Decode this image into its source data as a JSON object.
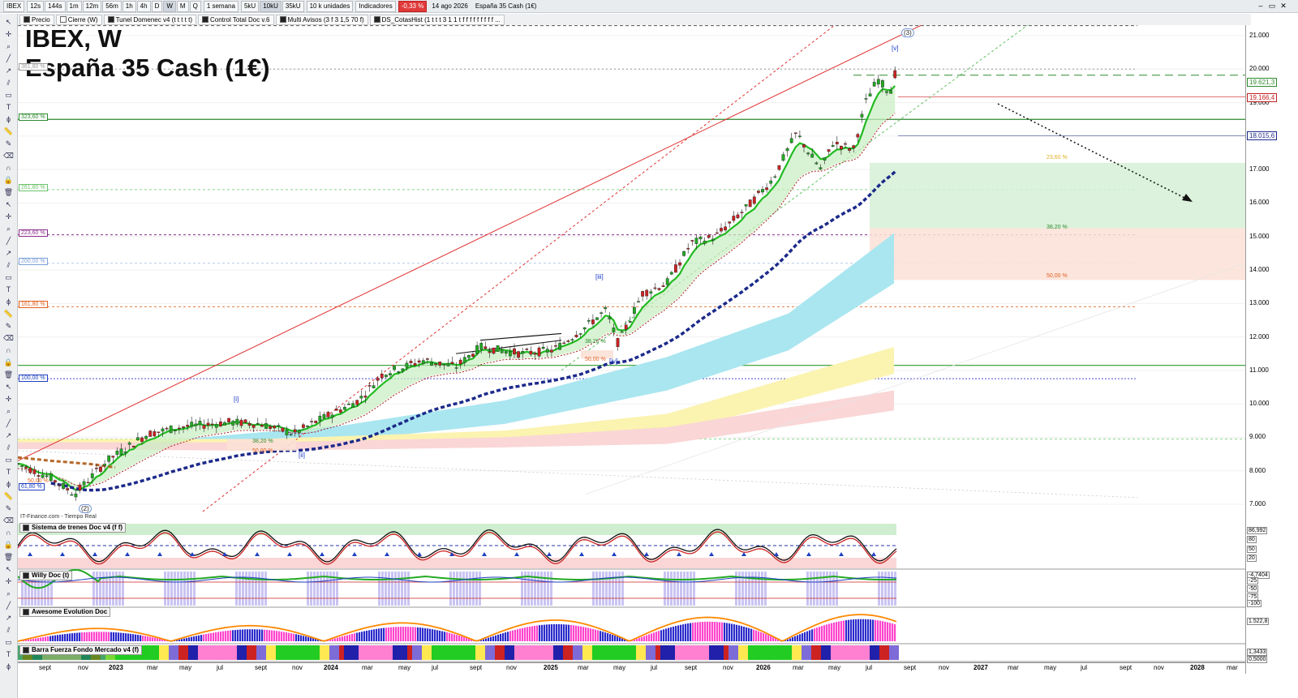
{
  "toolbar": {
    "symbol": "IBEX",
    "periods": [
      "12s",
      "144s",
      "1m",
      "12m",
      "56m",
      "1h",
      "4h",
      "D",
      "W",
      "M",
      "Q"
    ],
    "period_selected": "W",
    "timeframe": "1 semana",
    "units": [
      "5kU",
      "10kU",
      "35kU"
    ],
    "units_selected": "10kU",
    "units_count": "10 k unidades",
    "indicators_label": "Indicadores",
    "change": "-0,33 %",
    "date": "14 ago 2026",
    "instrument": "España 35 Cash (1€)"
  },
  "indicators_bar": [
    "Precio",
    "Cierre (W)",
    "Tunel Domenec v4 (t t t t t)",
    "Control Total Doc v.6",
    "Multi Avisos (3 f 3 1,5 70 f)",
    "DS_CotasHist (1 t t t 3 1 1 t f f f f f f f f f ..."
  ],
  "chart": {
    "title_line1": "IBEX, W",
    "title_line2": "España 35 Cash (1€)",
    "source": "IT-Finance.com - Tiempo Real",
    "price_ticks": [
      "21.000",
      "20.000",
      "19.000",
      "18.000",
      "17.000",
      "16.000",
      "15.000",
      "14.000",
      "13.000",
      "12.000",
      "11.000",
      "10.000",
      "9.000",
      "8.000",
      "7.000"
    ],
    "price_labels": [
      {
        "text": "19.621,3",
        "color": "#2d8a2d"
      },
      {
        "text": "19.166,4",
        "color": "#c02020"
      },
      {
        "text": "18.015,6",
        "color": "#1c2a8a"
      }
    ],
    "fibo_left": [
      {
        "text": "361,80 %",
        "color": "#999999"
      },
      {
        "text": "323,60 %",
        "color": "#2d8a2d"
      },
      {
        "text": "261,80 %",
        "color": "#6cc46c"
      },
      {
        "text": "223,60 %",
        "color": "#8a2c8a"
      },
      {
        "text": "200,00 %",
        "color": "#7da0d8"
      },
      {
        "text": "161,80 %",
        "color": "#e06020"
      },
      {
        "text": "100,00 %",
        "color": "#2040c0"
      },
      {
        "text": "61,80 %",
        "color": "#2040c0"
      }
    ],
    "fibo_zone": [
      "23,60 %",
      "38,20 %",
      "50,00 %"
    ],
    "waves": [
      "(3)",
      "[v]",
      "[iii]",
      "[iv]",
      "[i]",
      "[ii]",
      "(2)"
    ],
    "small_fibo": [
      "38,20 %",
      "50,00 %",
      "38,20 %",
      "50,00 %",
      "50,00 %"
    ]
  },
  "panels": [
    {
      "name": "Sistema de trenes Doc v4 (f f)",
      "scale": [
        "86,992",
        "80",
        "50",
        "20"
      ]
    },
    {
      "name": "Willy Doc (t)",
      "scale": [
        "-4,7404",
        "-25",
        "-50",
        "-75",
        "-100"
      ]
    },
    {
      "name": "Awesome Evolution Doc",
      "scale": [
        "1.522,8"
      ]
    },
    {
      "name": "Barra Fuerza Fondo Mercado v4 (f)",
      "scale": [
        "1,3433",
        "0,5000"
      ]
    }
  ],
  "xaxis": {
    "labels": [
      "sept",
      "nov",
      "2023",
      "mar",
      "may",
      "jul",
      "sept",
      "nov",
      "2024",
      "mar",
      "may",
      "jul",
      "sept",
      "nov",
      "2025",
      "mar",
      "may",
      "jul",
      "sept",
      "nov",
      "2026",
      "mar",
      "may",
      "jul",
      "sept",
      "nov",
      "2027",
      "mar",
      "may",
      "jul",
      "sept",
      "nov",
      "2028",
      "mar"
    ],
    "bold": [
      "2023",
      "2024",
      "2025",
      "2026",
      "2027",
      "2028"
    ]
  },
  "colors": {
    "up": "#22aa22",
    "down": "#cc2222",
    "ema": "#22bb22",
    "trend": "#1c2a8a",
    "channel": "#e02020"
  },
  "icons": [
    "cursor-icon",
    "crosshair-icon",
    "zoom-icon",
    "line-icon",
    "trend-icon",
    "channel-icon",
    "rectangle-icon",
    "text-icon",
    "fibo-icon",
    "ruler-icon",
    "pencil-icon",
    "eraser-icon",
    "magnet-icon",
    "lock-icon",
    "trash-icon"
  ]
}
